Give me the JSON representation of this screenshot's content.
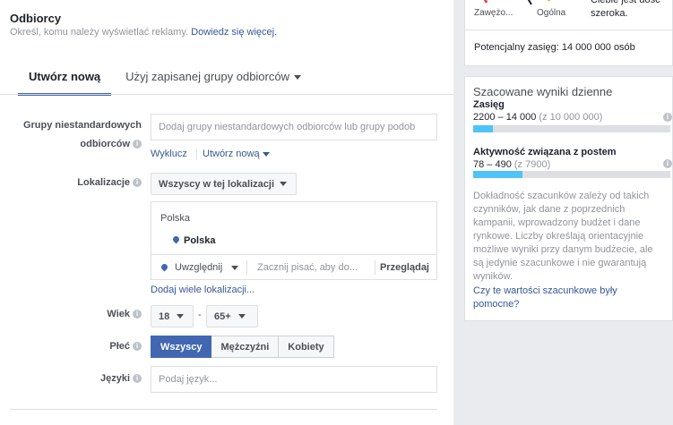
{
  "header": {
    "title": "Odbiorcy",
    "subtitle": "Określ, komu należy wyświetlać reklamy.",
    "learn_more": "Dowiedz się więcej."
  },
  "tabs": {
    "create_new": "Utwórz nową",
    "use_saved": "Użyj zapisanej grupy odbiorców"
  },
  "custom_audiences": {
    "label_line1": "Grupy niestandardowych",
    "label_line2": "odbiorców",
    "placeholder": "Dodaj grupy niestandardowych odbiorców lub grupy podob",
    "exclude": "Wyklucz",
    "create_new": "Utwórz nową"
  },
  "locations": {
    "label": "Lokalizacje",
    "dropdown": "Wszyscy w tej lokalizacji",
    "group_header": "Polska",
    "item": "Polska",
    "include": "Uwzględnij",
    "search_placeholder": "Zacznij pisać, aby do...",
    "browse": "Przeglądaj",
    "add_many": "Dodaj wiele lokalizacji..."
  },
  "age": {
    "label": "Wiek",
    "min": "18",
    "dash": "-",
    "max": "65+"
  },
  "gender": {
    "label": "Płeć",
    "options": [
      "Wszyscy",
      "Mężczyźni",
      "Kobiety"
    ],
    "selected": "Wszyscy"
  },
  "languages": {
    "label": "Języki",
    "placeholder": "Podaj język..."
  },
  "audience_size": {
    "gauge_left": "Zawężo...",
    "gauge_center": "Ogólna",
    "desc_line1": "Ciebie jest dość",
    "desc_line2": "szeroka.",
    "potential_reach": "Potencjalny zasięg: 14 000 000 osób"
  },
  "daily_results": {
    "title": "Szacowane wyniki dzienne",
    "reach_label": "Zasięg",
    "reach_value": "2200 – 14 000",
    "reach_of": "(z 10 000 000)",
    "reach_fill": 0.1,
    "engagement_label": "Aktywność związana z postem",
    "engagement_value": "78 – 490",
    "engagement_of": "(z 7900)",
    "engagement_fill": 0.25,
    "disclaimer": "Dokładność szacunków zależy od takich czynników, jak dane z poprzednich kampanii, wprowadzony budżet i dane rynkowe. Liczby określają orientacyjnie możliwe wyniki przy danym budżecie, ale są jedynie szacunkowe i nie gwarantują wyników.",
    "feedback": "Czy te wartości szacunkowe były pomocne?"
  },
  "colors": {
    "accent": "#4267b2",
    "link": "#365899",
    "bar": "#4fc3f7"
  }
}
